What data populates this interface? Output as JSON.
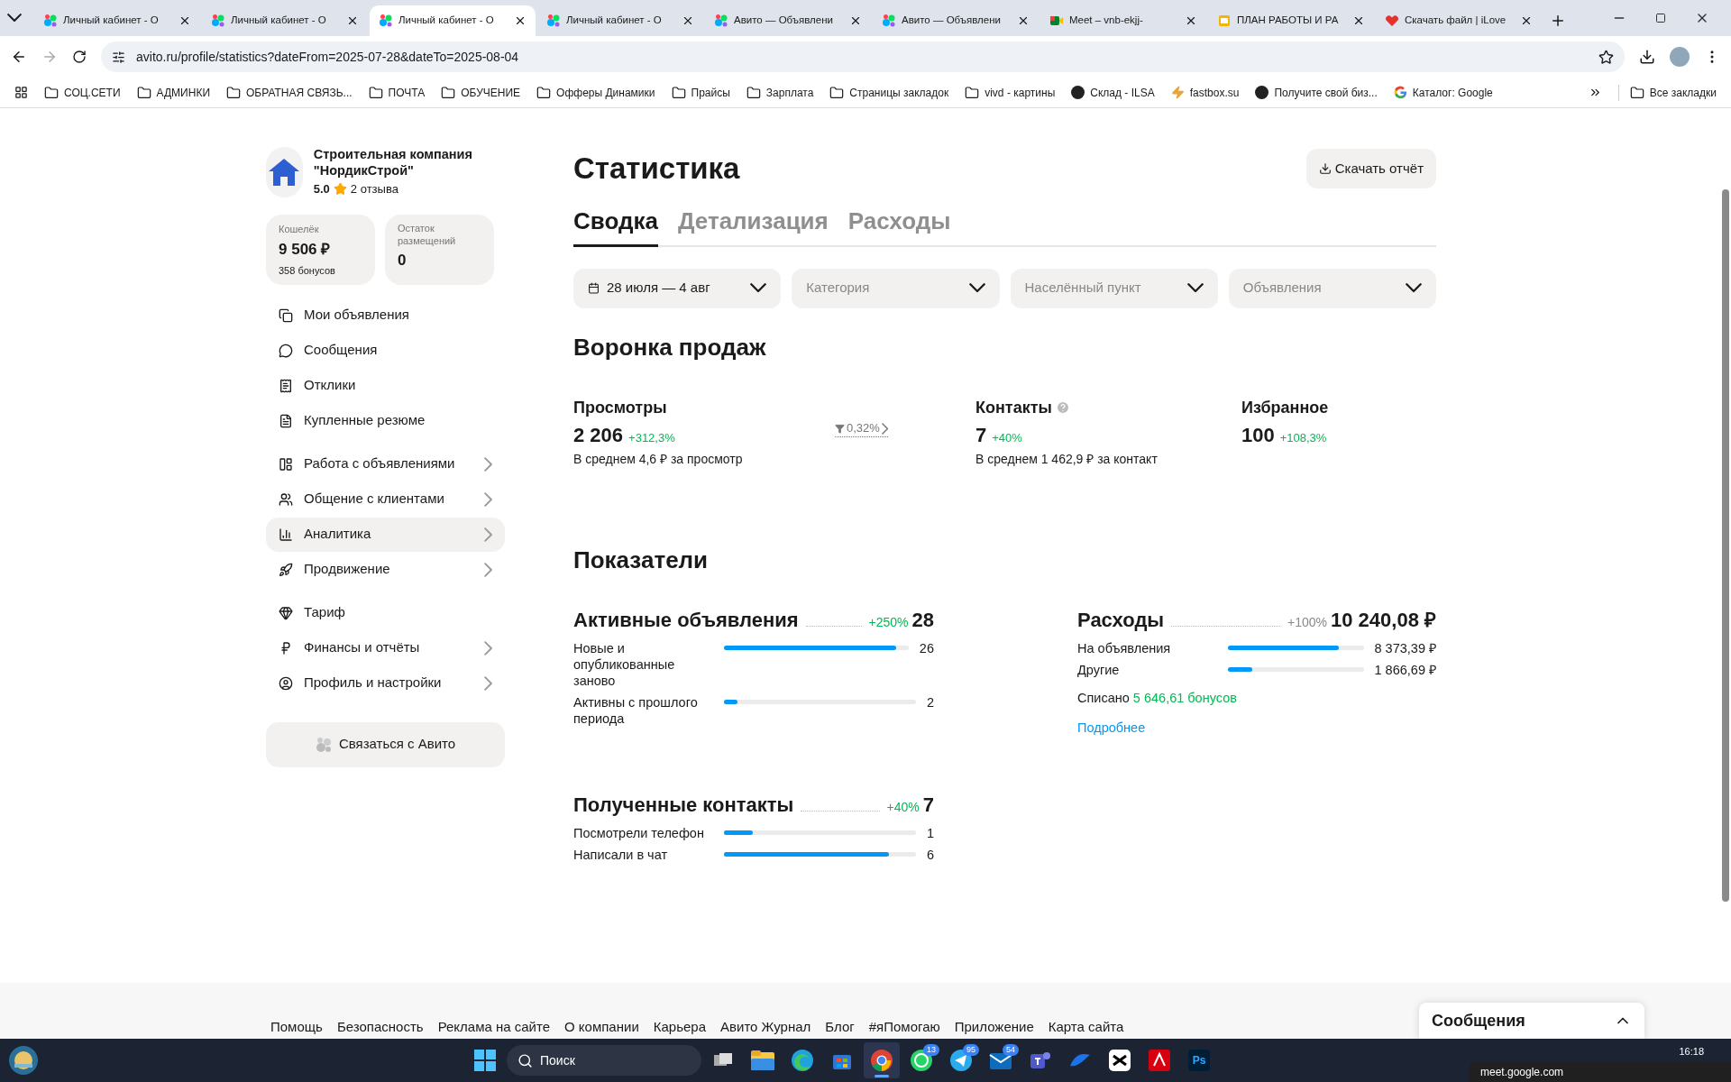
{
  "browser": {
    "tabs": [
      {
        "title": "Личный кабинет - О",
        "kind": "avito",
        "selected": false
      },
      {
        "title": "Личный кабинет - О",
        "kind": "avito",
        "selected": false
      },
      {
        "title": "Личный кабинет - О",
        "kind": "avito",
        "selected": true
      },
      {
        "title": "Личный кабинет - О",
        "kind": "avito",
        "selected": false
      },
      {
        "title": "Авито — Объявлени",
        "kind": "avito",
        "selected": false
      },
      {
        "title": "Авито — Объявлени",
        "kind": "avito",
        "selected": false
      },
      {
        "title": "Meet – vnb-ekjj-",
        "kind": "meet",
        "selected": false
      },
      {
        "title": "ПЛАН РАБОТЫ И РА",
        "kind": "slides",
        "selected": false
      },
      {
        "title": "Скачать файл | iLove",
        "kind": "heart",
        "selected": false
      }
    ],
    "url": "avito.ru/profile/statistics?dateFrom=2025-07-28&dateTo=2025-08-04",
    "bookmarks": [
      {
        "label": "СОЦ.СЕТИ",
        "kind": "folder"
      },
      {
        "label": "АДМИНКИ",
        "kind": "folder"
      },
      {
        "label": "ОБРАТНАЯ СВЯЗЬ...",
        "kind": "folder"
      },
      {
        "label": "ПОЧТА",
        "kind": "folder"
      },
      {
        "label": "ОБУЧЕНИЕ",
        "kind": "folder"
      },
      {
        "label": "Офферы Динамики",
        "kind": "folder"
      },
      {
        "label": "Прайсы",
        "kind": "folder"
      },
      {
        "label": "Зарплата",
        "kind": "folder"
      },
      {
        "label": "Страницы закладок",
        "kind": "folder"
      },
      {
        "label": "vivd - картины",
        "kind": "folder"
      },
      {
        "label": "Склад - ILSA",
        "kind": "site"
      },
      {
        "label": "fastbox.su",
        "kind": "bolt"
      },
      {
        "label": "Получите свой биз...",
        "kind": "site"
      },
      {
        "label": "Каталог: Google",
        "kind": "google"
      }
    ],
    "all_bookmarks": "Все закладки"
  },
  "profile": {
    "name": "Строительная компания \"НордикСтрой\"",
    "rating": "5.0",
    "reviews": "2 отзыва"
  },
  "wallet": {
    "label": "Кошелёк",
    "amount": "9 506 ₽",
    "bonus": "358 бонусов"
  },
  "placements": {
    "label": "Остаток размещений",
    "value": "0"
  },
  "menu": [
    {
      "label": "Мои объявления",
      "arrow": false,
      "selected": false
    },
    {
      "label": "Сообщения",
      "arrow": false,
      "selected": false
    },
    {
      "label": "Отклики",
      "arrow": false,
      "selected": false
    },
    {
      "label": "Купленные резюме",
      "arrow": false,
      "selected": false
    },
    {
      "label": "Работа с объявлениями",
      "arrow": true,
      "selected": false
    },
    {
      "label": "Общение с клиентами",
      "arrow": true,
      "selected": false
    },
    {
      "label": "Аналитика",
      "arrow": true,
      "selected": true
    },
    {
      "label": "Продвижение",
      "arrow": true,
      "selected": false
    },
    {
      "label": "Тариф",
      "arrow": false,
      "selected": false
    },
    {
      "label": "Финансы и отчёты",
      "arrow": true,
      "selected": false
    },
    {
      "label": "Профиль и настройки",
      "arrow": true,
      "selected": false
    }
  ],
  "contact_button": "Связаться с Авито",
  "title": "Статистика",
  "download_button": "Скачать отчёт",
  "tabs": [
    {
      "label": "Сводка",
      "selected": true
    },
    {
      "label": "Детализация",
      "selected": false
    },
    {
      "label": "Расходы",
      "selected": false
    }
  ],
  "filters": [
    {
      "value": "28 июля — 4 авг",
      "kind": "date"
    },
    {
      "placeholder": "Категория",
      "kind": "select"
    },
    {
      "placeholder": "Населённый пункт",
      "kind": "select"
    },
    {
      "placeholder": "Объявления",
      "kind": "select"
    }
  ],
  "funnel": {
    "title": "Воронка продаж",
    "views": {
      "label": "Просмотры",
      "value": "2 206",
      "change": "+312,3%",
      "note": "В среднем 4,6 ₽ за просмотр"
    },
    "conversion": "0,32%",
    "contacts": {
      "label": "Контакты",
      "value": "7",
      "change": "+40%",
      "note": "В среднем 1 462,9 ₽ за контакт"
    },
    "favorites": {
      "label": "Избранное",
      "value": "100",
      "change": "+108,3%"
    }
  },
  "indicators": {
    "title": "Показатели",
    "active": {
      "title": "Активные объявления",
      "change": "+250%",
      "total": "28",
      "rows": [
        {
          "label": "Новые и опубликованные заново",
          "level": 0.93,
          "value": "26"
        },
        {
          "label": "Активны с прошлого периода",
          "level": 0.07,
          "value": "2"
        }
      ]
    },
    "contacts": {
      "title": "Полученные контакты",
      "change": "+40%",
      "total": "7",
      "rows": [
        {
          "label": "Посмотрели телефон",
          "level": 0.15,
          "value": "1"
        },
        {
          "label": "Написали в чат",
          "level": 0.86,
          "value": "6"
        }
      ]
    },
    "expenses": {
      "title": "Расходы",
      "change": "+100%",
      "total": "10 240,08 ₽",
      "rows": [
        {
          "label": "На объявления",
          "level": 0.82,
          "value": "8 373,39 ₽"
        },
        {
          "label": "Другие",
          "level": 0.18,
          "value": "1 866,69 ₽"
        }
      ],
      "written_off": "Списано",
      "bonuses": "5 646,61 бонусов",
      "more": "Подробнее"
    }
  },
  "footer_links": [
    "Помощь",
    "Безопасность",
    "Реклама на сайте",
    "О компании",
    "Карьера",
    "Авито Журнал",
    "Блог",
    "#яПомогаю",
    "Приложение",
    "Карта сайта"
  ],
  "messages_widget": "Сообщения",
  "taskbar": {
    "search": "Поиск",
    "apps": [
      {
        "kind": "explorer",
        "selected": false
      },
      {
        "kind": "edge",
        "selected": false
      },
      {
        "kind": "store",
        "selected": false
      },
      {
        "kind": "chrome",
        "selected": true
      },
      {
        "kind": "whatsapp",
        "badge": "13",
        "selected": false
      },
      {
        "kind": "telegram",
        "badge": "95",
        "selected": false
      },
      {
        "kind": "mail",
        "badge": "54",
        "selected": false
      },
      {
        "kind": "teams",
        "selected": false
      },
      {
        "kind": "wave",
        "selected": false
      },
      {
        "kind": "capcut",
        "selected": false
      },
      {
        "kind": "acrobat",
        "selected": false
      },
      {
        "kind": "photoshop",
        "label": "Ps",
        "selected": false
      }
    ],
    "time": "16:18",
    "notification": "meet.google.com"
  }
}
